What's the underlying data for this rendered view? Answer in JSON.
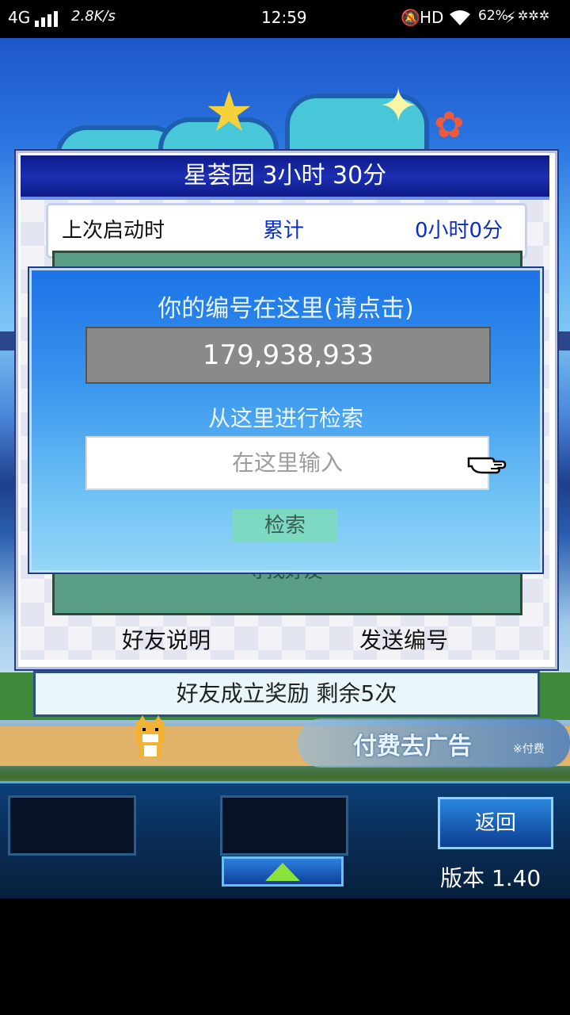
{
  "status_bar": {
    "network": "4G",
    "speed": "2.8K/s",
    "time": "12:59",
    "hd": "HD",
    "battery": "62%"
  },
  "header": {
    "title": "星荟园 3小时 30分"
  },
  "stats": {
    "last_start_label": "上次启动时",
    "total_label": "累计",
    "total_value": "0小时0分"
  },
  "friend_panel": {
    "find_friend": "寻找好友"
  },
  "modal": {
    "title": "你的编号在这里(请点击)",
    "number": "179,938,933",
    "search_label": "从这里进行检索",
    "search_placeholder": "在这里输入",
    "search_button": "检索"
  },
  "bottom_buttons": {
    "friend_explain": "好友说明",
    "send_number": "发送编号"
  },
  "reward": {
    "text": "好友成立奖励  剩余5次"
  },
  "ad": {
    "main": "付费去广告",
    "sub": "※付费"
  },
  "hud": {
    "return_label": "返回",
    "version": "版本 1.40"
  },
  "colors": {
    "header_bg": "#1c2fb2",
    "modal_bg": "#3b98ee",
    "accent_blue": "#0a2fc8",
    "panel_green": "#5b9e86"
  }
}
